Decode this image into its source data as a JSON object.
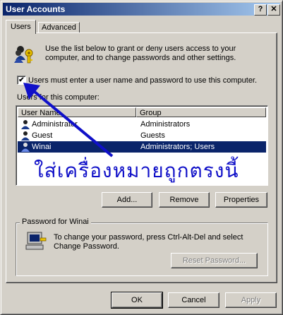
{
  "window": {
    "title": "User Accounts",
    "help_glyph": "?",
    "close_glyph": "✕"
  },
  "tabs": [
    {
      "label": "Users"
    },
    {
      "label": "Advanced"
    }
  ],
  "intro": {
    "line1": "Use the list below to grant or deny users access to your",
    "line2": "computer, and to change passwords and other settings."
  },
  "checkbox": {
    "checked": true,
    "mark": "✔",
    "label": "Users must enter a user name and password to use this computer."
  },
  "users_label": "Users for this computer:",
  "list": {
    "columns": [
      "User Name",
      "Group"
    ],
    "rows": [
      {
        "name": "Administrator",
        "group": "Administrators",
        "selected": false
      },
      {
        "name": "Guest",
        "group": "Guests",
        "selected": false
      },
      {
        "name": "Winai",
        "group": "Administrators; Users",
        "selected": true
      }
    ]
  },
  "annotation": {
    "text": "ใส่เครื่องหมายถูกตรงนี้",
    "color": "#1010c8"
  },
  "buttons": {
    "add": "Add...",
    "remove": "Remove",
    "properties": "Properties"
  },
  "password_group": {
    "title": "Password for Winai",
    "line1": "To change your password, press Ctrl-Alt-Del and select",
    "line2": "Change Password.",
    "reset_button": "Reset Password..."
  },
  "footer": {
    "ok": "OK",
    "cancel": "Cancel",
    "apply": "Apply"
  },
  "icons": {
    "users": "users-key-icon",
    "computer": "computer-key-icon",
    "user_row": "user-icon"
  },
  "colors": {
    "title_start": "#0a246a",
    "title_end": "#a6caf0",
    "selection": "#0a246a",
    "face": "#d4d0c8"
  }
}
